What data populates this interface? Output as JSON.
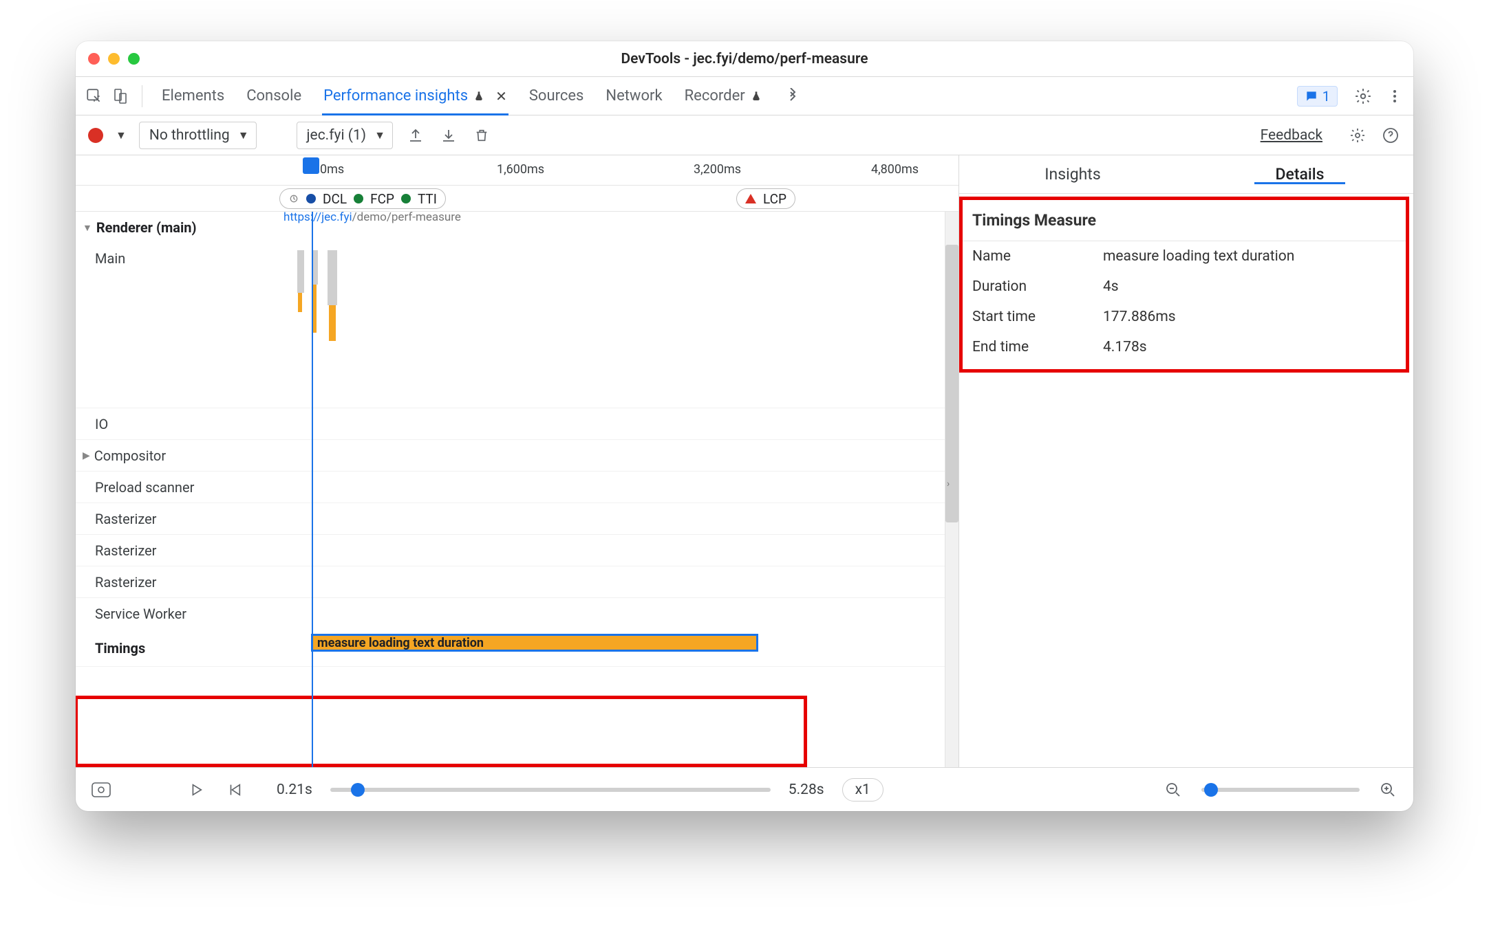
{
  "window": {
    "title": "DevTools - jec.fyi/demo/perf-measure"
  },
  "tabs": {
    "elements": "Elements",
    "console": "Console",
    "perf": "Performance insights",
    "sources": "Sources",
    "network": "Network",
    "recorder": "Recorder",
    "issues_count": "1"
  },
  "toolbar": {
    "throttle": "No throttling",
    "page": "jec.fyi (1)",
    "feedback": "Feedback"
  },
  "ruler": {
    "t0": "0ms",
    "t1": "1,600ms",
    "t2": "3,200ms",
    "t3": "4,800ms"
  },
  "markers": {
    "dcl": "DCL",
    "fcp": "FCP",
    "tti": "TTI",
    "lcp": "LCP"
  },
  "tracks": {
    "renderer": "Renderer (main)",
    "main": "Main",
    "io": "IO",
    "compositor": "Compositor",
    "preload": "Preload scanner",
    "raster1": "Rasterizer",
    "raster2": "Rasterizer",
    "raster3": "Rasterizer",
    "service": "Service Worker",
    "timings": "Timings",
    "url": "https://jec.fyi/demo/perf-measure"
  },
  "timings": {
    "bar_label": "measure loading text duration"
  },
  "right": {
    "tab_insights": "Insights",
    "tab_details": "Details",
    "section_title": "Timings Measure",
    "rows": {
      "name_k": "Name",
      "name_v": "measure loading text duration",
      "dur_k": "Duration",
      "dur_v": "4s",
      "st_k": "Start time",
      "st_v": "177.886ms",
      "et_k": "End time",
      "et_v": "4.178s"
    }
  },
  "bottom": {
    "start": "0.21s",
    "end": "5.28s",
    "speed": "x1"
  }
}
